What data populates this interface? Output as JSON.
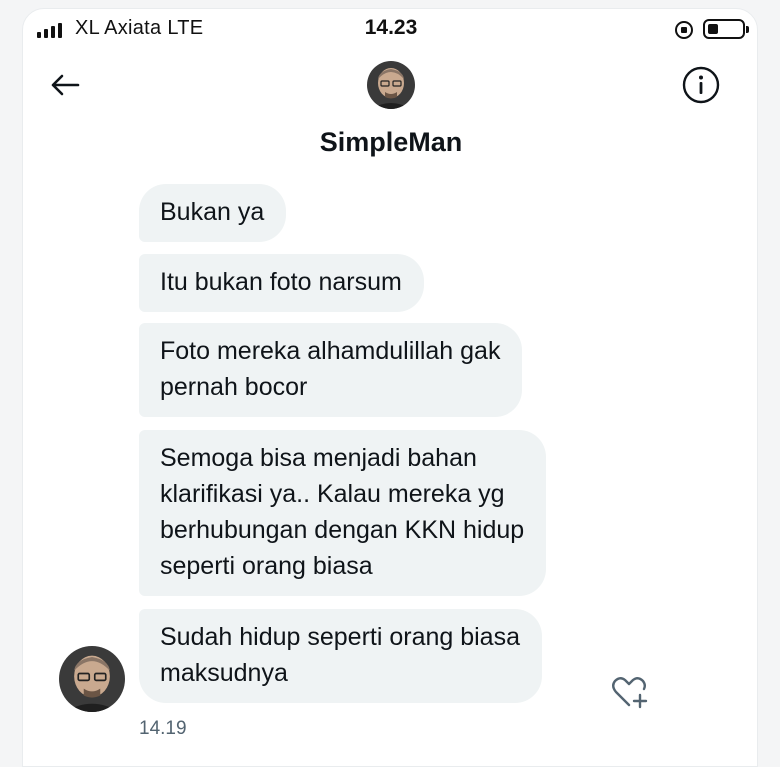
{
  "status_bar": {
    "carrier": "XL Axiata  LTE",
    "time": "14.23",
    "battery_level": 0.3,
    "signal_bars": 4
  },
  "header": {
    "back_icon": "arrow-left-icon",
    "info_icon": "info-circle-icon",
    "contact_name": "SimpleMan"
  },
  "messages": [
    {
      "text": "Bukan ya"
    },
    {
      "text": "Itu bukan foto narsum"
    },
    {
      "text": "Foto mereka alhamdulillah gak\npernah bocor"
    },
    {
      "text": "Semoga bisa menjadi bahan\nklarifikasi ya.. Kalau mereka yg\nberhubungan dengan KKN hidup\nseperti orang biasa"
    },
    {
      "text": "Sudah hidup seperti orang biasa\nmaksudnya"
    }
  ],
  "last_message_time": "14.19",
  "icons": {
    "like": "heart-plus-icon"
  },
  "colors": {
    "bubble_bg": "#eff3f4",
    "text": "#0f1419",
    "muted": "#536471"
  }
}
